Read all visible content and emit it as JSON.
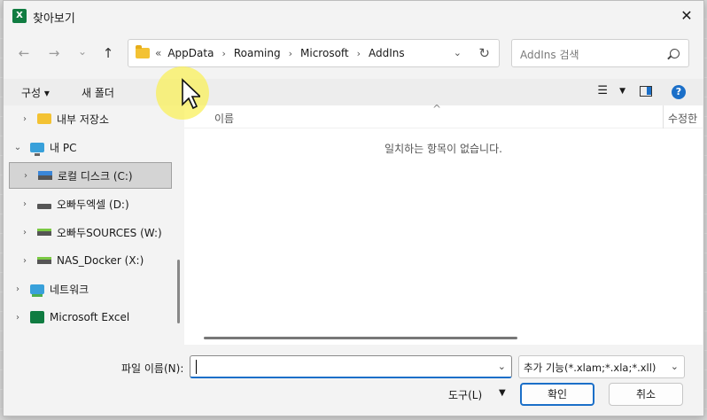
{
  "window": {
    "title": "찾아보기",
    "app_icon_letter": "X"
  },
  "nav": {
    "back": "←",
    "forward": "→",
    "recent": "⌄",
    "up": "↑"
  },
  "address": {
    "lead": "«",
    "crumbs": [
      "AppData",
      "Roaming",
      "Microsoft",
      "AddIns"
    ]
  },
  "search": {
    "placeholder": "AddIns 검색"
  },
  "toolbar": {
    "organize": "구성 ▾",
    "new_folder": "새 폴더",
    "help": "?"
  },
  "tree": [
    {
      "label": "내부 저장소",
      "icon": "folder-icon",
      "chev": "›"
    },
    {
      "label": "내 PC",
      "icon": "pc-icon",
      "chev": "⌄"
    },
    {
      "label": "로컬 디스크 (C:)",
      "icon": "windows-drive-icon",
      "chev": "›"
    },
    {
      "label": "오빠두엑셀 (D:)",
      "icon": "drive-icon",
      "chev": "›"
    },
    {
      "label": "오빠두SOURCES (W:)",
      "icon": "network-drive-icon",
      "chev": "›"
    },
    {
      "label": "NAS_Docker (X:)",
      "icon": "network-drive-icon",
      "chev": "›"
    },
    {
      "label": "네트워크",
      "icon": "network-icon",
      "chev": "›"
    },
    {
      "label": "Microsoft Excel",
      "icon": "excel-icon",
      "chev": "›"
    }
  ],
  "filelist": {
    "col_name": "이름",
    "col_date": "수정한",
    "sort_glyph": "^",
    "empty": "일치하는 항목이 없습니다."
  },
  "bottom": {
    "filename_label": "파일 이름(N):",
    "filename_value": "",
    "filter": "추가 기능(*.xlam;*.xla;*.xll)",
    "tools": "도구(L)",
    "ok": "확인",
    "cancel": "취소"
  },
  "colors": {
    "accent": "#1b6fc8",
    "excel_green": "#107c41",
    "folder_yellow": "#f3c233"
  }
}
